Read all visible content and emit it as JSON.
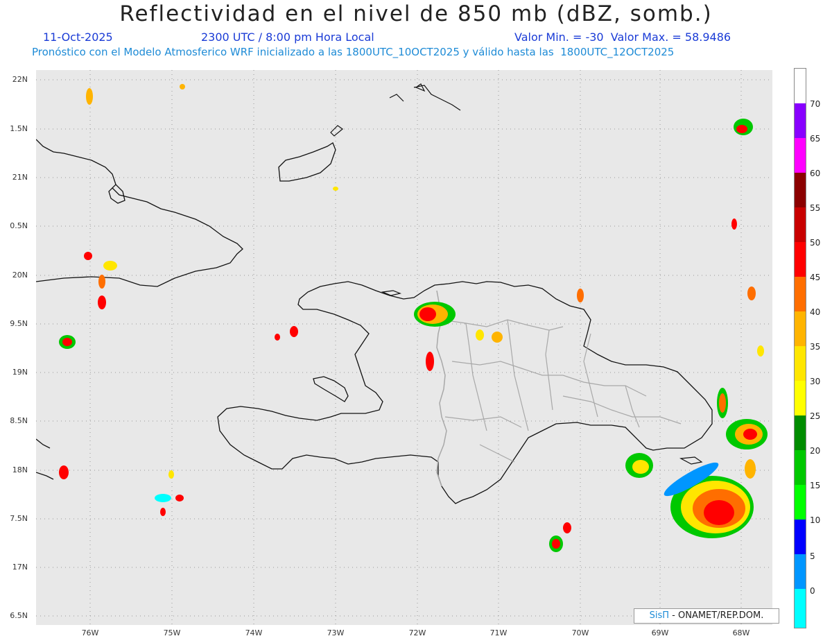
{
  "title": "Reflectividad en el nivel de 850 mb (dBZ, somb.)",
  "date": "11-Oct-2025",
  "time": "2300 UTC / 8:00 pm Hora Local",
  "minmax": "Valor Min. = -30  Valor Max. = 58.9486",
  "model_line": "Pronóstico con el Modelo Atmosferico WRF inicializado a las 1800UTC_10OCT2025 y válido hasta las  1800UTC_12OCT2025",
  "y_ticks": [
    "22N",
    "1.5N",
    "21N",
    "0.5N",
    "20N",
    "9.5N",
    "19N",
    "8.5N",
    "18N",
    "7.5N",
    "17N",
    "6.5N"
  ],
  "x_ticks": [
    "76W",
    "75W",
    "74W",
    "73W",
    "72W",
    "71W",
    "70W",
    "69W",
    "68W"
  ],
  "colorbar": {
    "labels": [
      "70",
      "65",
      "60",
      "55",
      "50",
      "45",
      "40",
      "35",
      "30",
      "25",
      "20",
      "15",
      "10",
      "5",
      "0"
    ],
    "colors": [
      "#ffffff",
      "#8800ff",
      "#ff00ff",
      "#8b0000",
      "#c80000",
      "#ff0000",
      "#ff6e00",
      "#ffb400",
      "#ffe600",
      "#ffff00",
      "#008c00",
      "#00c800",
      "#00ff00",
      "#0000ff",
      "#0096ff",
      "#00ffff",
      "#e8e8e8"
    ]
  },
  "credit": {
    "brand": "SisΠ",
    "text": " - ONAMET/REP.DOM."
  }
}
